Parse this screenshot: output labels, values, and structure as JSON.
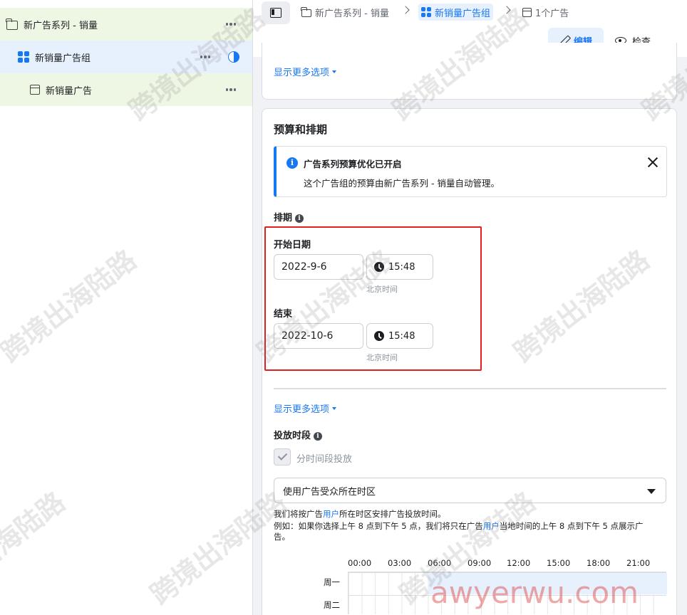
{
  "sidebar": {
    "campaign_label": "新广告系列 - 销量",
    "adset_label": "新销量广告组",
    "ad_label": "新销量广告"
  },
  "breadcrumb": {
    "campaign": "新广告系列 - 销量",
    "adset": "新销量广告组",
    "ads": "1个广告"
  },
  "toolbar": {
    "edit_label": "编辑",
    "view_label": "检查"
  },
  "top_card": {
    "more_options": "显示更多选项"
  },
  "budget": {
    "title": "预算和排期",
    "info_title": "广告系列预算优化已开启",
    "info_body": "这个广告组的预算由新广告系列 - 销量自动管理。",
    "schedule_label": "排期",
    "start_label": "开始日期",
    "start_date": "2022-9-6",
    "start_time": "15:48",
    "end_label": "结束",
    "end_date": "2022-10-6",
    "end_time": "15:48",
    "timezone": "北京时间",
    "more_options": "显示更多选项",
    "dayparting_label": "投放时段",
    "dayparting_checkbox": "分时间段投放",
    "timezone_select": "使用广告受众所在时区",
    "note_line1_a": "我们将按广告",
    "note_line1_hl": "用户",
    "note_line1_b": "所在时区安排广告投放时间。",
    "note_line2_a": "例如：如果你选择上午 8 点到下午 5 点，我们将只在广告",
    "note_line2_hl": "用户",
    "note_line2_b": "当地时间的上午 8 点到下午 5 点展示广",
    "note_line3": "告。",
    "hours": [
      "00:00",
      "03:00",
      "06:00",
      "09:00",
      "12:00",
      "15:00",
      "18:00",
      "21:00"
    ],
    "days": [
      "周一",
      "周二"
    ]
  },
  "watermark": {
    "text": "跨境出海陆路",
    "url": "awyerwu.com"
  },
  "colors": {
    "accent": "#1877f2",
    "highlight_border": "#e02020"
  }
}
